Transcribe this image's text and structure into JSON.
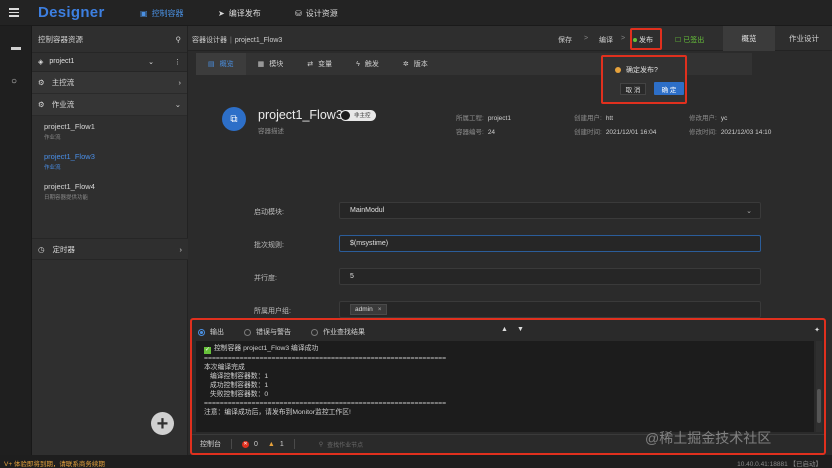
{
  "app": {
    "brand": "Designer",
    "nav": [
      {
        "icon": "monitor-icon",
        "label": "控制容器"
      },
      {
        "icon": "send-icon",
        "label": "编译发布"
      },
      {
        "icon": "database-icon",
        "label": "设计资源"
      }
    ]
  },
  "sidebar": {
    "title": "控制容器资源",
    "project": "project1",
    "groups": {
      "main_flow": "主控流",
      "job_flow": "作业流",
      "timer": "定时器"
    },
    "flows": [
      {
        "name": "project1_Flow1",
        "desc": "作业流"
      },
      {
        "name": "project1_Flow3",
        "desc": "作业流"
      },
      {
        "name": "project1_Flow4",
        "desc": "日期容器提供功能"
      }
    ]
  },
  "header": {
    "breadcrumb_root": "容器设计器",
    "breadcrumb_sep": "|",
    "breadcrumb_item": "project1_Flow3",
    "save": "保存",
    "compile": "编译",
    "publish": "发布",
    "signed_out": "已签出",
    "tab_overview": "概览",
    "tab_job_design": "作业设计",
    "arrow": ">"
  },
  "subtabs": [
    "概览",
    "模块",
    "变量",
    "触发",
    "版本"
  ],
  "overview": {
    "title": "project1_Flow3",
    "toggle_label": "非主控",
    "desc": "容器描述",
    "meta": {
      "project_label": "所属工程:",
      "project_value": "project1",
      "creator_label": "创建用户:",
      "creator_value": "htt",
      "modifier_label": "修改用户:",
      "modifier_value": "yc",
      "number_label": "容器编号:",
      "number_value": "24",
      "created_label": "创建时间:",
      "created_value": "2021/12/01 16:04",
      "modified_label": "修改时间:",
      "modified_value": "2021/12/03 14:10"
    },
    "form": {
      "start_module_label": "启动模块:",
      "start_module_value": "MainModul",
      "batch_rule_label": "批次规则:",
      "batch_rule_value": "$(msystime)",
      "parallel_label": "并行度:",
      "parallel_value": "5",
      "user_group_label": "所属用户组:",
      "user_group_tag": "admin"
    }
  },
  "popconfirm": {
    "question": "确定发布?",
    "cancel": "取 消",
    "ok": "确 定"
  },
  "console": {
    "tabs": [
      "输出",
      "错误与警告",
      "作业查找结果"
    ],
    "lines": [
      "控制容器 project1_Flow3 编译成功",
      "=============================================================",
      "本次编译完成",
      "  编译控制容器数：1",
      "  成功控制容器数：1",
      "  失败控制容器数：0",
      "=============================================================",
      "注意：编译成功后，请发布到Monitor监控工作区!"
    ],
    "footer_title": "控制台",
    "error_count": "0",
    "warning_count": "1",
    "search_placeholder": "查找作业节点"
  },
  "statusbar": {
    "left": "V+ 体验即将到期，请联系商务续期",
    "right": "10.40.0.41:18881 【已启动】"
  },
  "watermark": "@稀土掘金技术社区",
  "colors": {
    "accent": "#2d6fc8",
    "highlight": "#e0301e",
    "success": "#67c23a",
    "warning": "#e6a23c"
  }
}
